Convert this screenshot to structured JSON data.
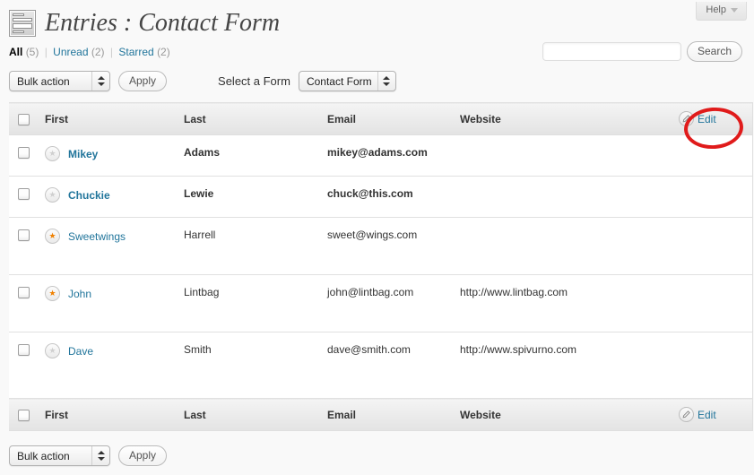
{
  "header": {
    "help_label": "Help",
    "help_icon": "chevron-down-icon",
    "icon_name": "entries-form-icon",
    "title": "Entries : Contact Form"
  },
  "search": {
    "value": "",
    "placeholder": "",
    "button_label": "Search"
  },
  "filters": {
    "separator": "|",
    "items": [
      {
        "label": "All",
        "count": "(5)",
        "current": true
      },
      {
        "label": "Unread",
        "count": "(2)",
        "current": false
      },
      {
        "label": "Starred",
        "count": "(2)",
        "current": false
      }
    ]
  },
  "toolbar_top": {
    "bulk_action_value": "Bulk action",
    "apply_label": "Apply",
    "select_form_label": "Select a Form",
    "form_value": "Contact Form"
  },
  "toolbar_bottom": {
    "bulk_action_value": "Bulk action",
    "apply_label": "Apply"
  },
  "table": {
    "columns": {
      "first": "First",
      "last": "Last",
      "email": "Email",
      "website": "Website"
    },
    "edit_label": "Edit",
    "edit_icon": "pencil-icon",
    "checkbox_icon": "checkbox-unchecked-icon",
    "star_icon": "star-icon",
    "rows": [
      {
        "first": "Mikey",
        "last": "Adams",
        "email": "mikey@adams.com",
        "website": "",
        "starred": false,
        "unread": true,
        "height": "h-md"
      },
      {
        "first": "Chuckie",
        "last": "Lewie",
        "email": "chuck@this.com",
        "website": "",
        "starred": false,
        "unread": true,
        "height": "h-md"
      },
      {
        "first": "Sweetwings",
        "last": "Harrell",
        "email": "sweet@wings.com",
        "website": "",
        "starred": true,
        "unread": false,
        "height": "h-lg"
      },
      {
        "first": "John",
        "last": "Lintbag",
        "email": "john@lintbag.com",
        "website": "http://www.lintbag.com",
        "starred": true,
        "unread": false,
        "height": "h-lg"
      },
      {
        "first": "Dave",
        "last": "Smith",
        "email": "dave@smith.com",
        "website": "http://www.spivurno.com",
        "starred": false,
        "unread": false,
        "height": "h-xl"
      }
    ]
  },
  "annotation": {
    "shape": "ellipse",
    "color": "#e01b1b",
    "targets": "edit-link-header"
  }
}
